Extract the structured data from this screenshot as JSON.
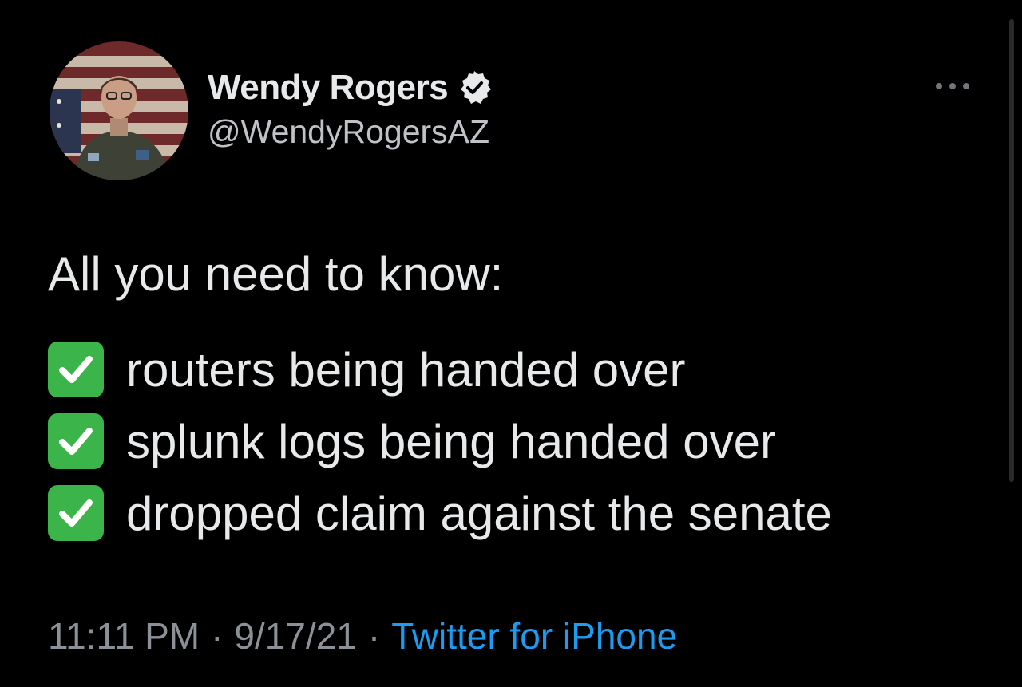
{
  "author": {
    "display_name": "Wendy Rogers",
    "handle": "@WendyRogersAZ",
    "verified": true
  },
  "tweet": {
    "intro": "All you need to know:",
    "items": [
      "routers being handed over",
      "splunk logs being handed over",
      "dropped claim against the senate"
    ]
  },
  "meta": {
    "time": "11:11 PM",
    "separator": "·",
    "date": "9/17/21",
    "source": "Twitter for iPhone"
  },
  "icons": {
    "verified": "verified-badge-icon",
    "check": "check-mark-button-emoji",
    "more": "more-options-icon"
  },
  "colors": {
    "background": "#000000",
    "text": "#e7e9ea",
    "secondary": "#8b9196",
    "link": "#1d9bf0",
    "check_green": "#3bb54a"
  }
}
